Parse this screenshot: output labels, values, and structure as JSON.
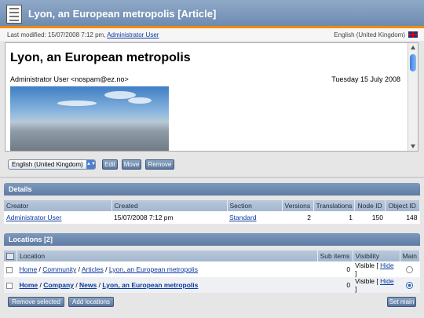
{
  "window": {
    "title": "Lyon, an European metropolis [Article]"
  },
  "meta": {
    "last_modified_prefix": "Last modified: 15/07/2008 7:12 pm, ",
    "last_modified_user": "Administrator User",
    "language": "English (United Kingdom)"
  },
  "preview": {
    "heading": "Lyon, an European metropolis",
    "author": "Administrator User <nospam@ez.no>",
    "date": "Tuesday 15 July 2008"
  },
  "language_select": {
    "value": "English (United Kingdom)"
  },
  "actions": {
    "edit": "Edit",
    "move": "Move",
    "remove": "Remove"
  },
  "details": {
    "title": "Details",
    "columns": [
      "Creator",
      "Created",
      "Section",
      "Versions",
      "Translations",
      "Node ID",
      "Object ID"
    ],
    "row": {
      "creator": "Administrator User",
      "created": "15/07/2008 7:12 pm",
      "section": "Standard",
      "versions": "2",
      "translations": "1",
      "node_id": "150",
      "object_id": "148"
    }
  },
  "locations": {
    "title": "Locations [2]",
    "columns": {
      "location": "Location",
      "sub_items": "Sub items",
      "visibility": "Visibility",
      "main": "Main"
    },
    "rows": [
      {
        "path": [
          "Home",
          "Community",
          "Articles",
          "Lyon, an European metropolis"
        ],
        "sub_items": "0",
        "visibility": "Visible",
        "hide": "Hide"
      },
      {
        "path": [
          "Home",
          "Company",
          "News",
          "Lyon, an European metropolis"
        ],
        "sub_items": "0",
        "visibility": "Visible",
        "hide": "Hide"
      }
    ],
    "remove_selected": "Remove selected",
    "add_locations": "Add locations",
    "set_main": "Set main"
  }
}
